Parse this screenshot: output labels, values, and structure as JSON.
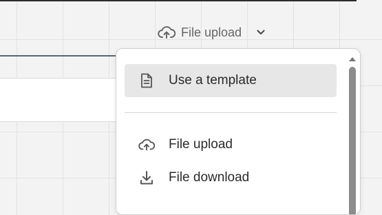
{
  "header": {
    "upload_label": "File upload",
    "upload_icon": "cloud-upload-icon",
    "dropdown_icon": "chevron-down-icon"
  },
  "menu": {
    "items": [
      {
        "label": "Use a template",
        "icon": "document-icon",
        "highlighted": true
      },
      {
        "label": "File upload",
        "icon": "cloud-upload-icon",
        "highlighted": false
      },
      {
        "label": "File download",
        "icon": "download-icon",
        "highlighted": false
      }
    ]
  },
  "colors": {
    "menu_highlight": "#e7e7e7",
    "text": "#2a2a2a",
    "trigger_text": "#666666",
    "scrollbar": "#8c8c8c"
  }
}
